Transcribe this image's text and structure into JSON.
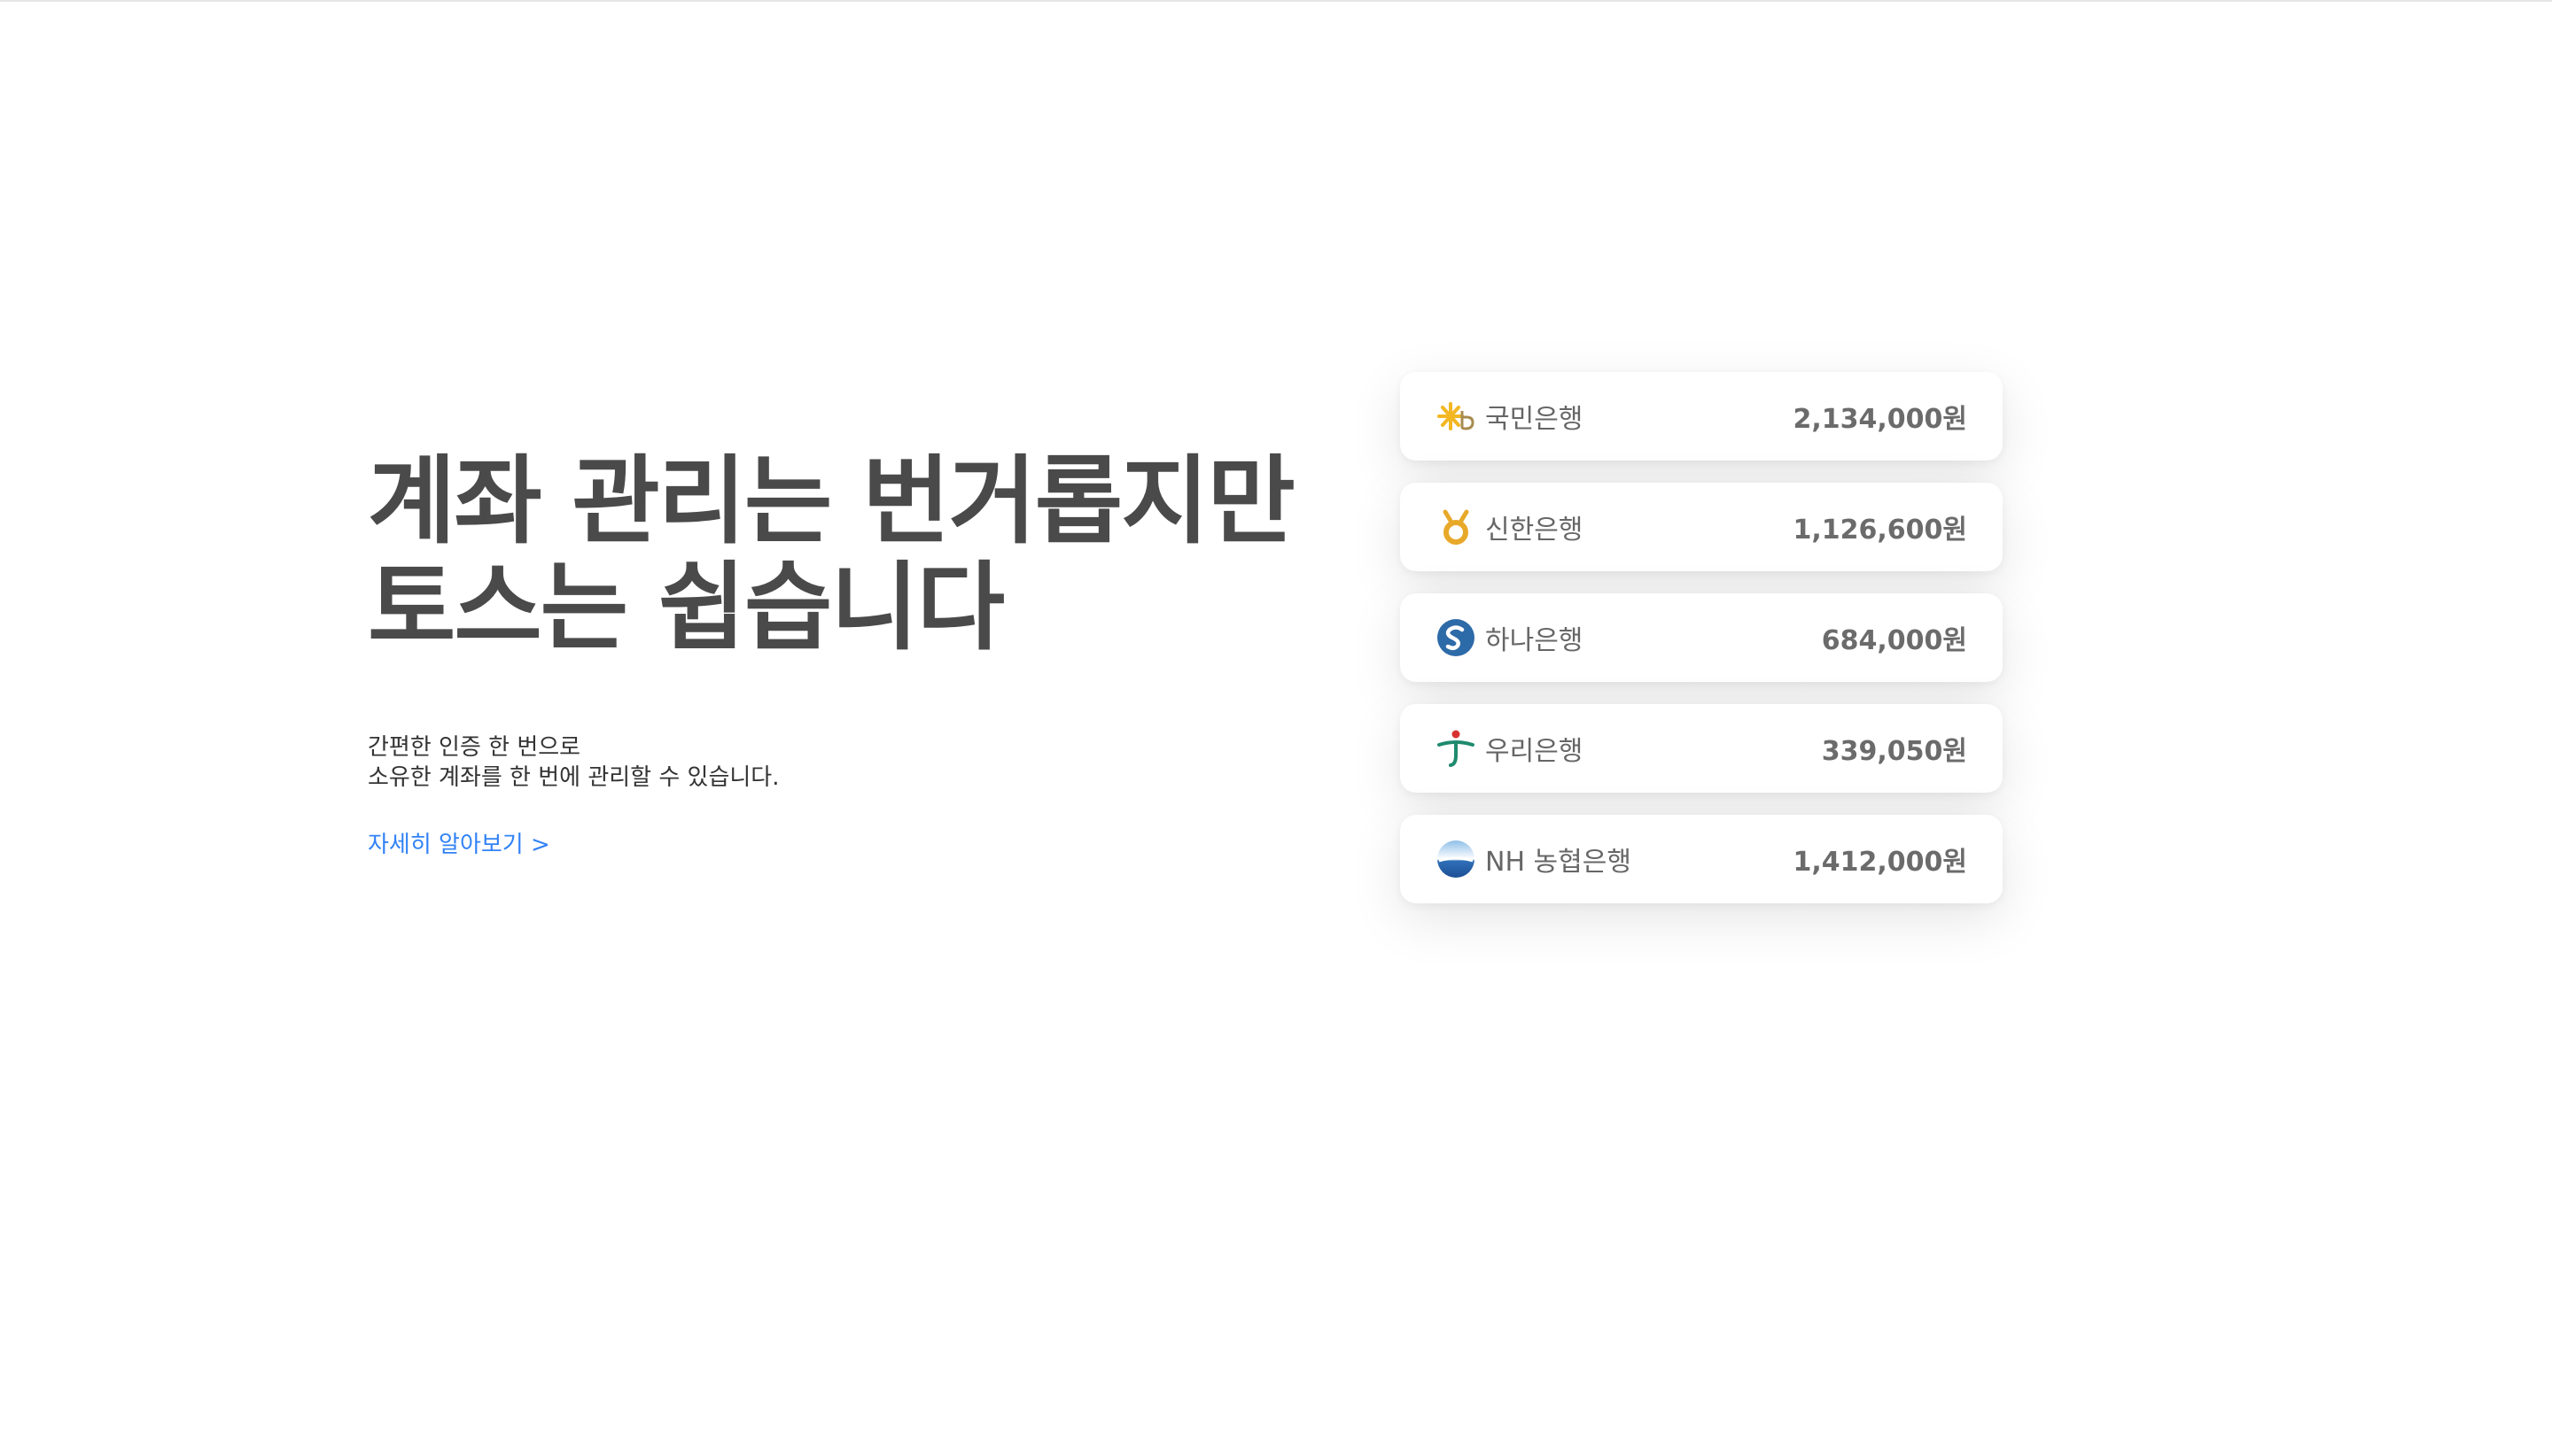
{
  "hero": {
    "headline_line1": "계좌 관리는 번거롭지만",
    "headline_line2": "토스는 쉽습니다",
    "subtitle_line1": "간편한 인증 한 번으로",
    "subtitle_line2": "소유한 계좌를 한 번에 관리할 수 있습니다.",
    "learn_more": "자세히 알아보기 >"
  },
  "accounts": [
    {
      "bank": "국민은행",
      "amount": "2,134,000원",
      "icon": "kb-logo-icon"
    },
    {
      "bank": "신한은행",
      "amount": "1,126,600원",
      "icon": "shinhan-logo-icon"
    },
    {
      "bank": "하나은행",
      "amount": "684,000원",
      "icon": "hana-logo-icon"
    },
    {
      "bank": "우리은행",
      "amount": "339,050원",
      "icon": "woori-logo-icon"
    },
    {
      "bank": "NH 농협은행",
      "amount": "1,412,000원",
      "icon": "nh-logo-icon"
    }
  ],
  "colors": {
    "link": "#3182f6",
    "headline": "#4a4a4a",
    "kb": "#f2b722",
    "shinhan": "#e8a92a",
    "hana": "#2d6aa8",
    "woori": "#1f8a6e",
    "nh": "#2f6fb8"
  }
}
